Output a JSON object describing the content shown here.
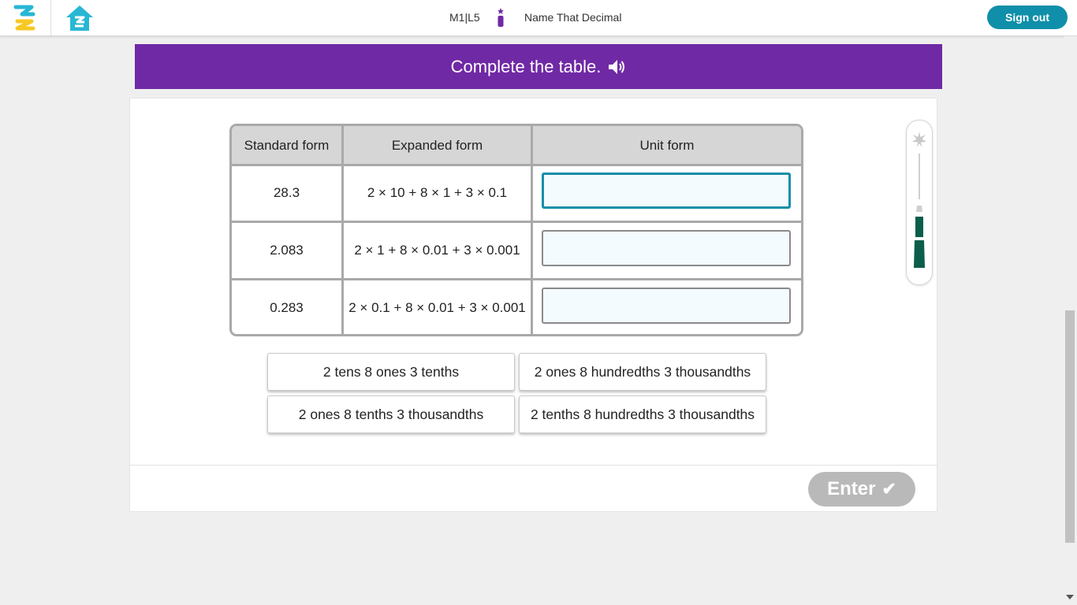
{
  "header": {
    "lesson_code": "M1|L5",
    "activity_title": "Name That Decimal",
    "sign_out_label": "Sign out"
  },
  "prompt": {
    "text": "Complete the table.",
    "speaker_icon": "speaker-icon"
  },
  "table": {
    "headers": [
      "Standard form",
      "Expanded form",
      "Unit form"
    ],
    "rows": [
      {
        "standard": "28.3",
        "expanded": "2 × 10 + 8 × 1 + 3 × 0.1",
        "unit": ""
      },
      {
        "standard": "2.083",
        "expanded": "2 × 1 + 8 × 0.01 + 3 × 0.001",
        "unit": ""
      },
      {
        "standard": "0.283",
        "expanded": "2 × 0.1 + 8 × 0.01 + 3 × 0.001",
        "unit": ""
      }
    ]
  },
  "choices": [
    "2 tens 8 ones 3 tenths",
    "2 ones 8 hundredths 3 thousandths",
    "2 ones 8 tenths 3 thousandths",
    "2 tenths 8 hundredths 3 thousandths"
  ],
  "progress": {
    "completed_segments": 2,
    "total_segments": 4
  },
  "actions": {
    "enter_label": "Enter",
    "enter_icon": "checkmark-icon"
  },
  "colors": {
    "accent": "#0f8fa9",
    "banner": "#7029a5",
    "progress_fill": "#0b5e4a",
    "enter_disabled": "#b9b9b9"
  }
}
